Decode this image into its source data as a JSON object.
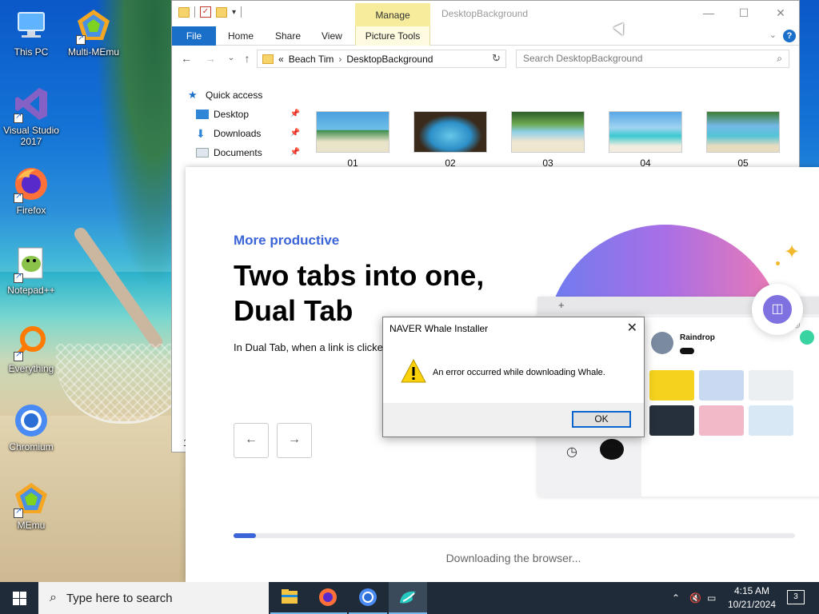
{
  "desktop": {
    "icons": [
      {
        "label": "This PC",
        "icon": "computer-icon"
      },
      {
        "label": "Multi-MEmu",
        "icon": "memu-icon"
      },
      {
        "label": "Visual Studio 2017",
        "icon": "visual-studio-icon"
      },
      {
        "label": "Firefox",
        "icon": "firefox-icon"
      },
      {
        "label": "Notepad++",
        "icon": "notepad-plus-plus-icon"
      },
      {
        "label": "Everything",
        "icon": "everything-search-icon"
      },
      {
        "label": "Chromium",
        "icon": "chromium-icon"
      },
      {
        "label": "MEmu",
        "icon": "memu-icon"
      }
    ]
  },
  "explorer": {
    "title": "DesktopBackground",
    "contextual_tab": "Manage",
    "ribbon_tabs": [
      "File",
      "Home",
      "Share",
      "View",
      "Picture Tools"
    ],
    "breadcrumb": {
      "prefix": "«",
      "parts": [
        "Beach Tim",
        "DesktopBackground"
      ]
    },
    "search_placeholder": "Search DesktopBackground",
    "nav": {
      "quick_access": "Quick access",
      "items": [
        "Desktop",
        "Downloads",
        "Documents"
      ]
    },
    "thumbnails": [
      "01",
      "02",
      "03",
      "04",
      "05"
    ],
    "partial_text": "1"
  },
  "whale": {
    "kicker": "More productive",
    "heading": "Two tabs into one, Dual Tab",
    "body": "In Dual Tab, when a link is clicked the right tab.",
    "mock": {
      "profile_name": "Raindrop"
    },
    "progress": 0.04,
    "status": "Downloading the browser..."
  },
  "error_dialog": {
    "title": "NAVER Whale Installer",
    "message": "An error occurred while downloading Whale.",
    "ok_label": "OK"
  },
  "taskbar": {
    "search_placeholder": "Type here to search",
    "apps": [
      "file-explorer-icon",
      "firefox-icon",
      "chromium-icon",
      "whale-icon"
    ],
    "time": "4:15 AM",
    "date": "10/21/2024",
    "notification_count": "3"
  },
  "colors": {
    "accent": "#3a64d8",
    "explorer_file_tab": "#1a6fc9",
    "manage_tab": "#f6ec9c",
    "taskbar": "#1f2b38"
  }
}
